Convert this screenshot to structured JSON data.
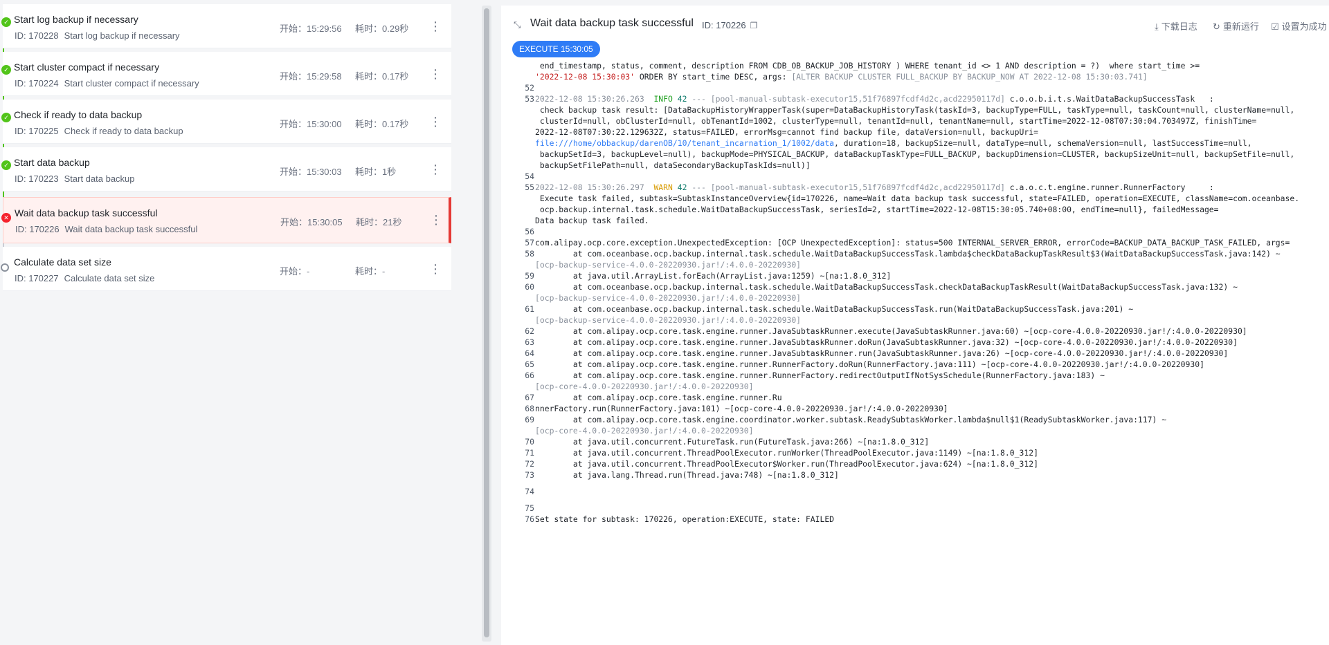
{
  "tasks": [
    {
      "title": "Start log backup if necessary",
      "id": "ID: 170228",
      "desc": "Start log backup if necessary",
      "start": "开始：15:29:56",
      "duration": "耗时：0.29秒",
      "status": "success"
    },
    {
      "title": "Start cluster compact if necessary",
      "id": "ID: 170224",
      "desc": "Start cluster compact if necessary",
      "start": "开始：15:29:58",
      "duration": "耗时：0.17秒",
      "status": "success"
    },
    {
      "title": "Check if ready to data backup",
      "id": "ID: 170225",
      "desc": "Check if ready to data backup",
      "start": "开始：15:30:00",
      "duration": "耗时：0.17秒",
      "status": "success"
    },
    {
      "title": "Start data backup",
      "id": "ID: 170223",
      "desc": "Start data backup",
      "start": "开始：15:30:03",
      "duration": "耗时：1秒",
      "status": "success"
    },
    {
      "title": "Wait data backup task successful",
      "id": "ID: 170226",
      "desc": "Wait data backup task successful",
      "start": "开始：15:30:05",
      "duration": "耗时：21秒",
      "status": "failed"
    },
    {
      "title": "Calculate data set size",
      "id": "ID: 170227",
      "desc": "Calculate data set size",
      "start": "开始：-",
      "duration": "耗时：-",
      "status": "pending"
    }
  ],
  "detail": {
    "title": "Wait data backup task successful",
    "id": "ID: 170226",
    "actions": {
      "download": "下载日志",
      "rerun": "重新运行",
      "set_success": "设置为成功"
    },
    "exec_tag": "EXECUTE 15:30:05"
  },
  "log": {
    "l0": " end_timestamp, status, comment, description FROM CDB_OB_BACKUP_JOB_HISTORY ) WHERE tenant_id <> 1 AND description = ?)  where start_time >=",
    "l0b_q": "'2022-12-08 15:30:03'",
    "l0b_r": " ORDER BY start_time DESC, args: ",
    "l0b_g": "[ALTER BACKUP CLUSTER FULL_BACKUP BY BACKUP_NOW AT 2022-12-08 15:30:03.741]",
    "n52": "52",
    "n53": "53",
    "l53_ts": "2022-12-08 15:30:26.263",
    "l53_lvl": "INFO",
    "l53_pid": "42",
    "l53_thr": " --- [pool-manual-subtask-executor15,51f76897fcdf4d2c,acd22950117d]",
    "l53_cls": " c.o.o.b.i.t.s.WaitDataBackupSuccessTask   :",
    "l53b": " check backup task result: [DataBackupHistoryWrapperTask(super=DataBackupHistoryTask(taskId=3, backupType=FULL, taskType=null, taskCount=null, clusterName=null,",
    "l53c": " clusterId=null, obClusterId=null, obTenantId=1002, clusterType=null, tenantId=null, tenantName=null, startTime=2022-12-08T07:30:04.703497Z, finishTime=",
    "l53d": "2022-12-08T07:30:22.129632Z, status=FAILED, errorMsg=cannot find backup file, dataVersion=null, backupUri=",
    "l53e_link": "file:///home/obbackup/darenOB/10/tenant_incarnation_1/1002/data",
    "l53e_rest": ", duration=18, backupSize=null, dataType=null, schemaVersion=null, lastSuccessTime=null,",
    "l53f": " backupSetId=3, backupLevel=null), backupMode=PHYSICAL_BACKUP, dataBackupTaskType=FULL_BACKUP, backupDimension=CLUSTER, backupSizeUnit=null, backupSetFile=null,",
    "l53g": " backupSetFilePath=null, dataSecondaryBackupTaskIds=null)]",
    "n54": "54",
    "n55": "55",
    "l55_ts": "2022-12-08 15:30:26.297",
    "l55_lvl": "WARN",
    "l55_pid": "42",
    "l55_thr": " --- [pool-manual-subtask-executor15,51f76897fcdf4d2c,acd22950117d]",
    "l55_cls": " c.a.o.c.t.engine.runner.RunnerFactory     :",
    "l55b": " Execute task failed, subtask=SubtaskInstanceOverview{id=170226, name=Wait data backup task successful, state=FAILED, operation=EXECUTE, className=com.oceanbase.",
    "l55c": " ocp.backup.internal.task.schedule.WaitDataBackupSuccessTask, seriesId=2, startTime=2022-12-08T15:30:05.740+08:00, endTime=null}, failedMessage=",
    "l55d": "Data backup task failed.",
    "n56": "56",
    "n57": "57",
    "l57": "com.alipay.ocp.core.exception.UnexpectedException: [OCP UnexpectedException]: status=500 INTERNAL_SERVER_ERROR, errorCode=BACKUP_DATA_BACKUP_TASK_FAILED, args=",
    "n58": "58",
    "l58": "        at com.oceanbase.ocp.backup.internal.task.schedule.WaitDataBackupSuccessTask.lambda$checkDataBackupTaskResult$3(WaitDataBackupSuccessTask.java:142) ~",
    "l58b": "[ocp-backup-service-4.0.0-20220930.jar!/:4.0.0-20220930]",
    "n59": "59",
    "l59": "        at java.util.ArrayList.forEach(ArrayList.java:1259) ~[na:1.8.0_312]",
    "n60": "60",
    "l60": "        at com.oceanbase.ocp.backup.internal.task.schedule.WaitDataBackupSuccessTask.checkDataBackupTaskResult(WaitDataBackupSuccessTask.java:132) ~",
    "l60b": "[ocp-backup-service-4.0.0-20220930.jar!/:4.0.0-20220930]",
    "n61": "61",
    "l61": "        at com.oceanbase.ocp.backup.internal.task.schedule.WaitDataBackupSuccessTask.run(WaitDataBackupSuccessTask.java:201) ~",
    "l61b": "[ocp-backup-service-4.0.0-20220930.jar!/:4.0.0-20220930]",
    "n62": "62",
    "l62": "        at com.alipay.ocp.core.task.engine.runner.JavaSubtaskRunner.execute(JavaSubtaskRunner.java:60) ~[ocp-core-4.0.0-20220930.jar!/:4.0.0-20220930]",
    "n63": "63",
    "l63": "        at com.alipay.ocp.core.task.engine.runner.JavaSubtaskRunner.doRun(JavaSubtaskRunner.java:32) ~[ocp-core-4.0.0-20220930.jar!/:4.0.0-20220930]",
    "n64": "64",
    "l64": "        at com.alipay.ocp.core.task.engine.runner.JavaSubtaskRunner.run(JavaSubtaskRunner.java:26) ~[ocp-core-4.0.0-20220930.jar!/:4.0.0-20220930]",
    "n65": "65",
    "l65": "        at com.alipay.ocp.core.task.engine.runner.RunnerFactory.doRun(RunnerFactory.java:111) ~[ocp-core-4.0.0-20220930.jar!/:4.0.0-20220930]",
    "n66": "66",
    "l66": "        at com.alipay.ocp.core.task.engine.runner.RunnerFactory.redirectOutputIfNotSysSchedule(RunnerFactory.java:183) ~",
    "l66b": "[ocp-core-4.0.0-20220930.jar!/:4.0.0-20220930]",
    "n67": "67",
    "l67": "        at com.alipay.ocp.core.task.engine.runner.Ru",
    "n68": "68",
    "l68": "nnerFactory.run(RunnerFactory.java:101) ~[ocp-core-4.0.0-20220930.jar!/:4.0.0-20220930]",
    "n69": "69",
    "l69": "        at com.alipay.ocp.core.task.engine.coordinator.worker.subtask.ReadySubtaskWorker.lambda$null$1(ReadySubtaskWorker.java:117) ~",
    "l69b": "[ocp-core-4.0.0-20220930.jar!/:4.0.0-20220930]",
    "n70": "70",
    "l70": "        at java.util.concurrent.FutureTask.run(FutureTask.java:266) ~[na:1.8.0_312]",
    "n71": "71",
    "l71": "        at java.util.concurrent.ThreadPoolExecutor.runWorker(ThreadPoolExecutor.java:1149) ~[na:1.8.0_312]",
    "n72": "72",
    "l72": "        at java.util.concurrent.ThreadPoolExecutor$Worker.run(ThreadPoolExecutor.java:624) ~[na:1.8.0_312]",
    "n73": "73",
    "l73": "        at java.lang.Thread.run(Thread.java:748) ~[na:1.8.0_312]",
    "n74": "74",
    "n75": "75",
    "n76": "76",
    "l76": "Set state for subtask: 170226, operation:EXECUTE, state: FAILED"
  },
  "icons": {
    "success": "check-icon",
    "failed": "close-icon",
    "pending": "circle-icon",
    "more": "more-vertical-icon",
    "collapse": "collapse-icon",
    "copy": "copy-icon",
    "download": "download-icon",
    "rerun": "refresh-icon",
    "set_success": "checkbox-icon"
  },
  "colors": {
    "success": "#52c41a",
    "failed": "#f5222d",
    "accent": "#2f7cf6",
    "info": "#20a020",
    "warn": "#d89b00"
  }
}
